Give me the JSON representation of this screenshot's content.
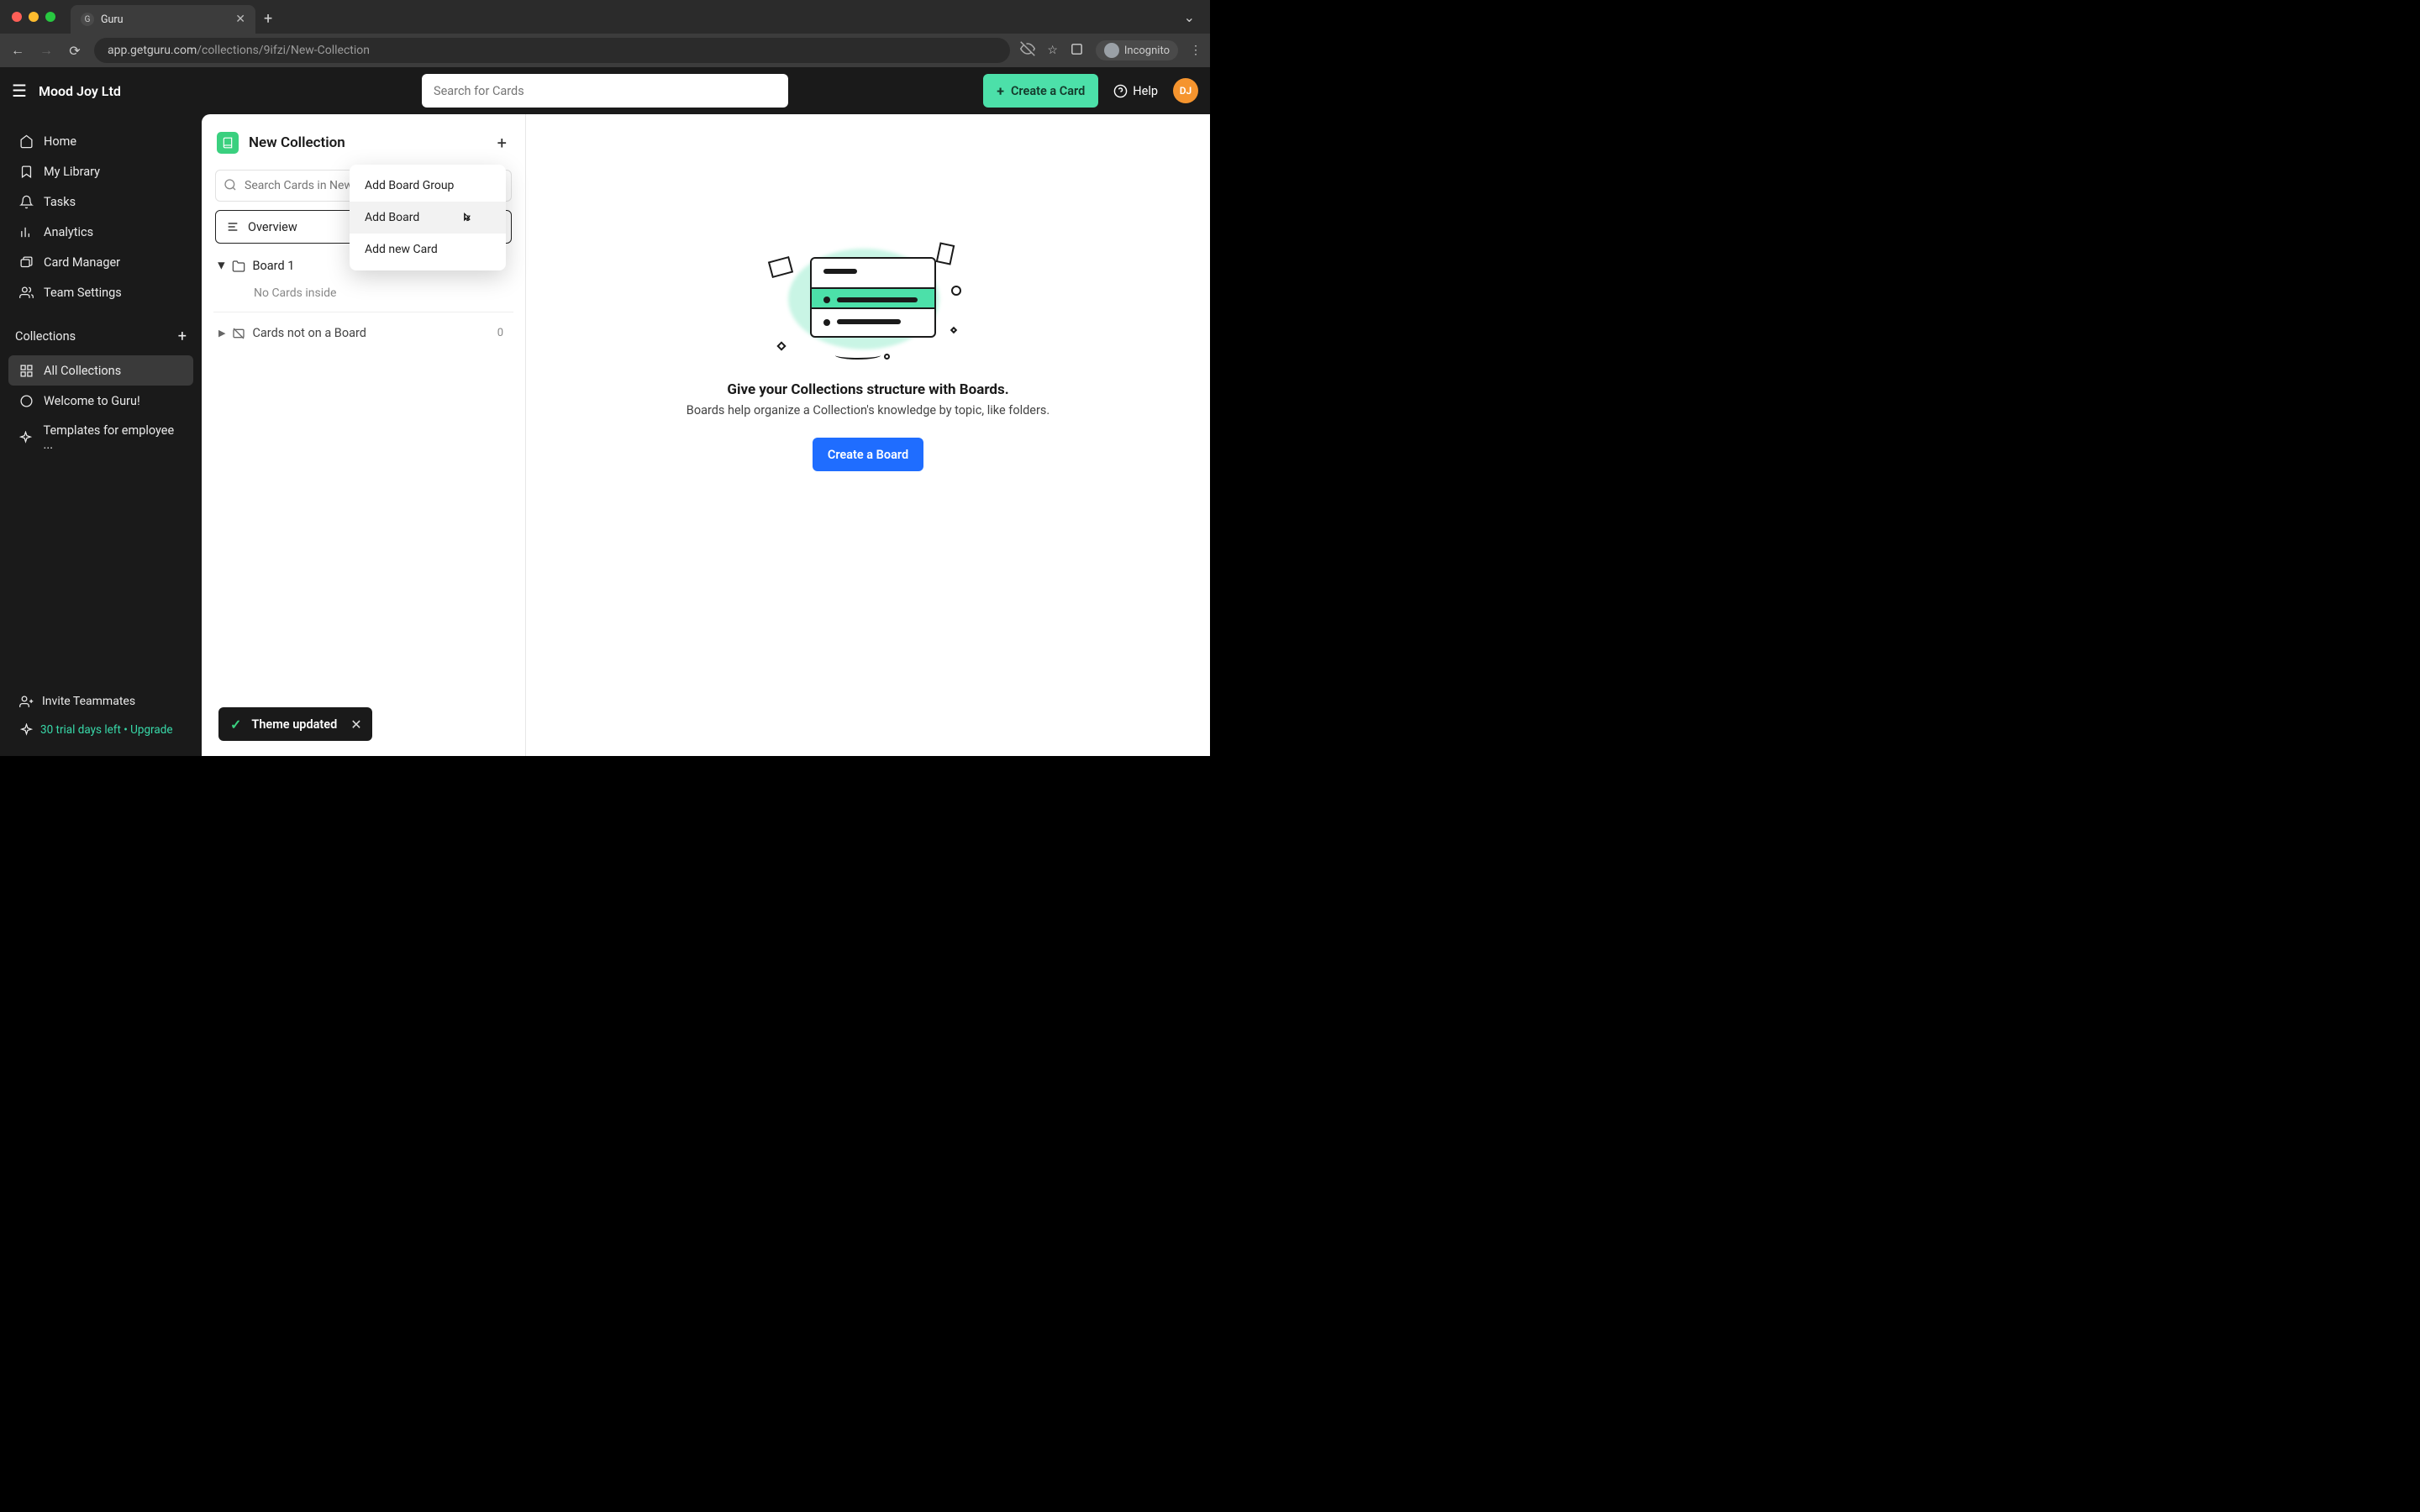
{
  "browser": {
    "tab_title": "Guru",
    "url_host": "app.getguru.com",
    "url_path": "/collections/9ifzi/New-Collection",
    "incognito_label": "Incognito"
  },
  "topbar": {
    "brand": "Mood Joy Ltd",
    "search_placeholder": "Search for Cards",
    "create_card_label": "Create a Card",
    "help_label": "Help",
    "avatar_initials": "DJ"
  },
  "sidebar": {
    "items": [
      {
        "label": "Home"
      },
      {
        "label": "My Library"
      },
      {
        "label": "Tasks"
      },
      {
        "label": "Analytics"
      },
      {
        "label": "Card Manager"
      },
      {
        "label": "Team Settings"
      }
    ],
    "collections_header": "Collections",
    "collections": [
      {
        "label": "All Collections",
        "active": true
      },
      {
        "label": "Welcome to Guru!"
      },
      {
        "label": "Templates for employee ..."
      }
    ],
    "invite_label": "Invite Teammates",
    "trial_label": "30 trial days left • Upgrade"
  },
  "collection_panel": {
    "title": "New Collection",
    "search_placeholder": "Search Cards in New Co",
    "overview_label": "Overview",
    "board_name": "Board 1",
    "no_cards_label": "No Cards inside",
    "not_on_board_label": "Cards not on a Board",
    "not_on_board_count": "0"
  },
  "dropdown": {
    "items": [
      {
        "label": "Add Board Group"
      },
      {
        "label": "Add Board"
      },
      {
        "label": "Add new Card"
      }
    ]
  },
  "empty_state": {
    "title": "Give your Collections structure with Boards.",
    "subtitle": "Boards help organize a Collection's knowledge by topic, like folders.",
    "button": "Create a Board"
  },
  "toast": {
    "message": "Theme updated"
  }
}
